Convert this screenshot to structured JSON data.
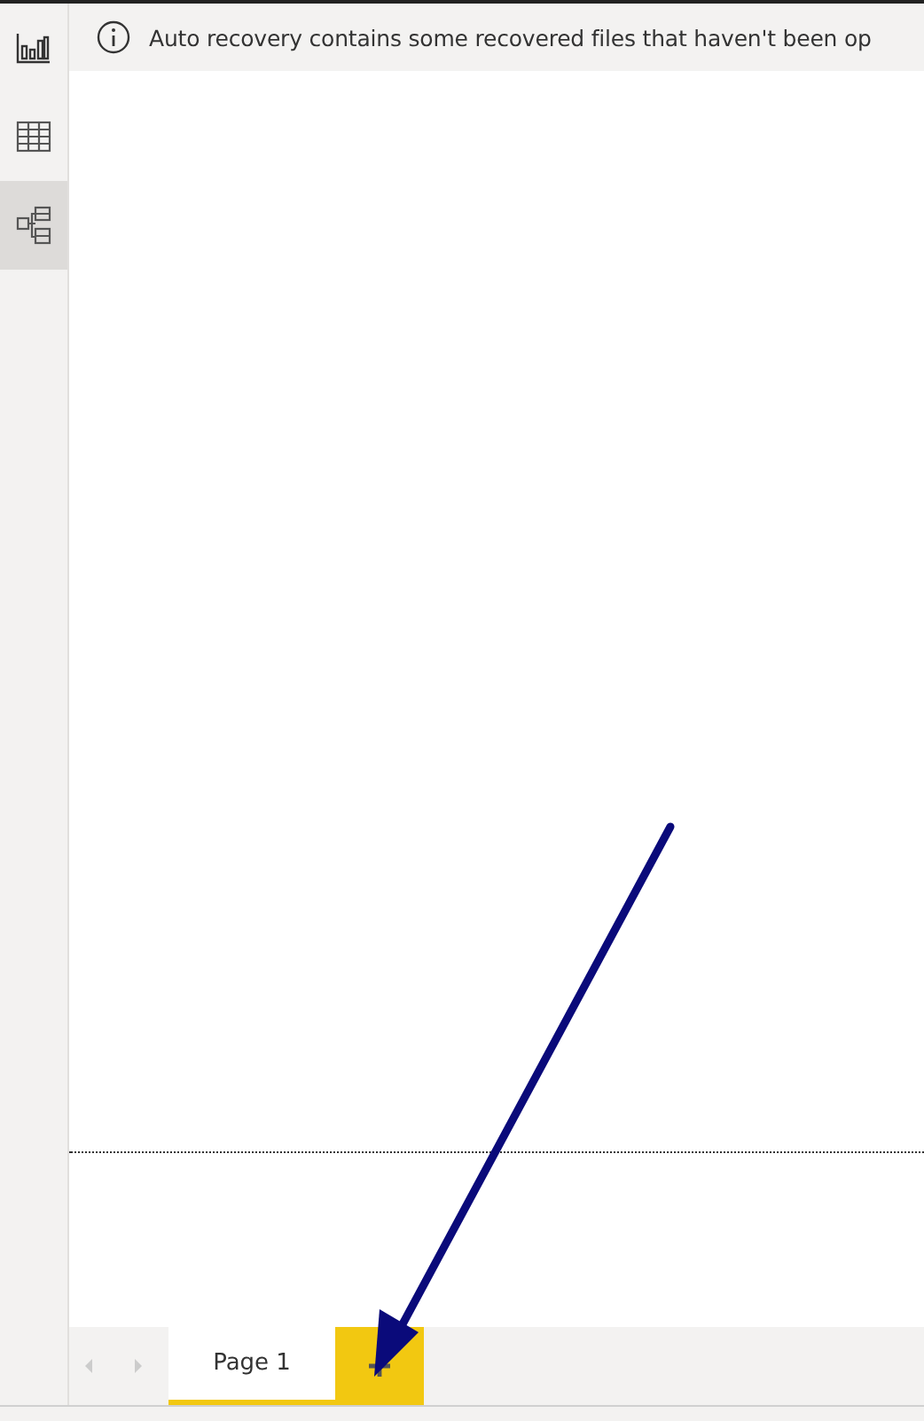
{
  "sidebar": {
    "items": [
      {
        "kind": "report",
        "selected": false
      },
      {
        "kind": "data",
        "selected": false
      },
      {
        "kind": "model",
        "selected": true
      }
    ]
  },
  "message_bar": {
    "text": "Auto recovery contains some recovered files that haven't been op"
  },
  "page_tabs": [
    {
      "label": "Page 1",
      "selected": true
    }
  ]
}
